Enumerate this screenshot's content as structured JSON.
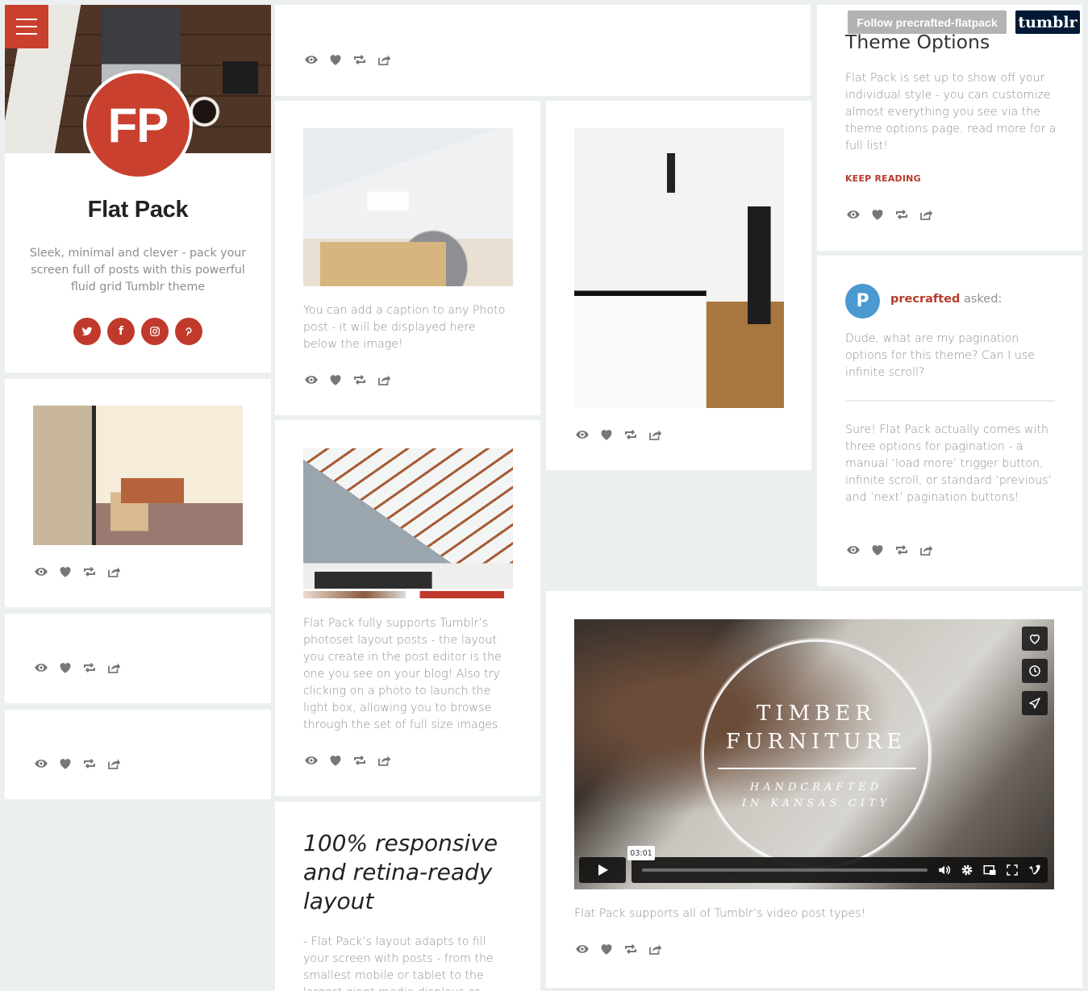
{
  "profile": {
    "menu_icon": "hamburger-menu-icon",
    "avatar_initials": "FP",
    "title": "Flat Pack",
    "description": "Sleek, minimal and clever - pack your screen full of posts with this powerful fluid grid Tumblr theme",
    "socials": [
      {
        "name": "twitter",
        "icon": "twitter-icon"
      },
      {
        "name": "facebook",
        "icon": "facebook-icon",
        "glyph": "f"
      },
      {
        "name": "instagram",
        "icon": "instagram-icon"
      },
      {
        "name": "pinterest",
        "icon": "pinterest-icon",
        "glyph": "P"
      }
    ]
  },
  "top_bar": {
    "follow_label": "Follow precrafted-flatpack",
    "tumblr_label": "tumblr"
  },
  "posts": {
    "attic_photo": {
      "caption": "You can add a caption to any Photo post - it will be displayed here below the image!"
    },
    "photoset": {
      "caption": "Flat Pack fully supports Tumblr’s photoset layout posts - the layout you create in the post editor is the one you see on your blog! Also try clicking on a photo to launch the light box, allowing you to browse through the set of full size images."
    },
    "text_post": {
      "heading": "100% responsive and retina-ready layout",
      "body": "- Flat Pack’s layout adapts to fill your screen with posts - from the smallest mobile or tablet to the largest giant media displays or"
    },
    "theme_options": {
      "title": "Theme Options",
      "body": "Flat Pack is set up to show off your individual style - you can customize almost everything you see via the theme options page, read more for a full list!",
      "keep_reading": "KEEP READING"
    },
    "ask": {
      "avatar_letter": "P",
      "asker": "precrafted",
      "asked_label": "asked:",
      "question": "Dude, what are my pagination options for this theme? Can I use infinite scroll?",
      "answer": "Sure! Flat Pack actually comes with three options for pagination - a manual ‘load more’ trigger button, infinite scroll, or standard ‘previous’ and ‘next’ pagination buttons!"
    },
    "video": {
      "title_line1": "TIMBER",
      "title_line2": "FURNITURE",
      "subtitle_line1": "HANDCRAFTED",
      "subtitle_line2": "IN KANSAS CITY",
      "time_tooltip": "03:01",
      "progress_fraction": 0,
      "side_buttons": [
        "like-icon",
        "watch-later-icon",
        "share-icon"
      ],
      "controls": [
        "volume-icon",
        "settings-icon",
        "pip-icon",
        "fullscreen-icon",
        "vimeo-logo-icon"
      ],
      "caption": "Flat Pack supports all of Tumblr’s video post types!"
    }
  },
  "post_actions": [
    "view-icon",
    "like-icon",
    "reblog-icon",
    "share-icon"
  ],
  "colors": {
    "accent": "#c9402f",
    "link": "#b73a2c",
    "background": "#eceff0",
    "text": "#8b8f92",
    "tumblr_navy": "#001935"
  }
}
